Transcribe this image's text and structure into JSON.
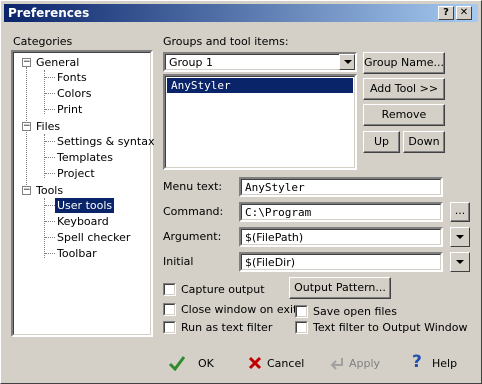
{
  "window": {
    "title": "Preferences",
    "help_btn": "?",
    "close_btn": "✕"
  },
  "categories": {
    "label": "Categories",
    "tree": [
      {
        "label": "General",
        "expanded": true,
        "children": [
          "Fonts",
          "Colors",
          "Print"
        ]
      },
      {
        "label": "Files",
        "expanded": true,
        "children": [
          "Settings & syntax",
          "Templates",
          "Project"
        ]
      },
      {
        "label": "Tools",
        "expanded": true,
        "children": [
          "User tools",
          "Keyboard",
          "Spell checker",
          "Toolbar"
        ]
      }
    ],
    "selected": "User tools"
  },
  "groups": {
    "label": "Groups and tool items:",
    "group_select": "Group 1",
    "items": [
      "AnyStyler"
    ],
    "buttons": {
      "group_name": "Group Name...",
      "add_tool": "Add Tool >>",
      "remove": "Remove",
      "up": "Up",
      "down": "Down"
    }
  },
  "fields": {
    "menu_text_label": "Menu text:",
    "menu_text_value": "AnyStyler",
    "command_label": "Command:",
    "command_value": "C:\\Program Files\\AnyStyler\\AnySt",
    "browse_btn": "...",
    "argument_label": "Argument:",
    "argument_value": "$(FilePath)",
    "initial_label": "Initial",
    "initial_value": "$(FileDir)"
  },
  "options": {
    "capture_output": "Capture output",
    "output_pattern": "Output Pattern...",
    "close_window": "Close window on exit",
    "save_open_files": "Save open files",
    "run_as_filter": "Run as text filter",
    "text_filter_output": "Text filter to Output Window"
  },
  "footer": {
    "ok": "OK",
    "cancel": "Cancel",
    "apply": "Apply",
    "help": "Help"
  },
  "colors": {
    "accent": "#0a246a",
    "ok_check": "#2e8b2e",
    "cancel_x": "#c00000",
    "help_q": "#1e4fb0"
  }
}
